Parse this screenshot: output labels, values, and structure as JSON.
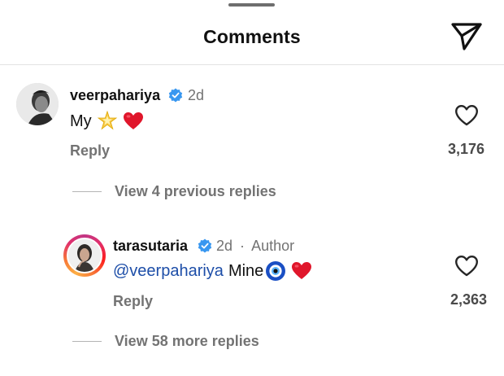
{
  "header": {
    "title": "Comments"
  },
  "comments": [
    {
      "username": "veerpahariya",
      "time": "2d",
      "text": "My",
      "emojis": [
        "star",
        "heart"
      ],
      "reply_label": "Reply",
      "like_count": "3,176"
    }
  ],
  "view_previous": "View 4 previous replies",
  "reply": {
    "username": "tarasutaria",
    "time": "2d",
    "author_tag": "Author",
    "separator": "·",
    "mention": "@veerpahariya",
    "text": "Mine",
    "emojis": [
      "nazar-amulet",
      "heart"
    ],
    "reply_label": "Reply",
    "like_count": "2,363"
  },
  "view_more": "View 58 more replies",
  "colors": {
    "verified": "#3897f0",
    "heart_red": "#e0162b",
    "mention": "#1d4ea8",
    "muted": "#737373"
  }
}
